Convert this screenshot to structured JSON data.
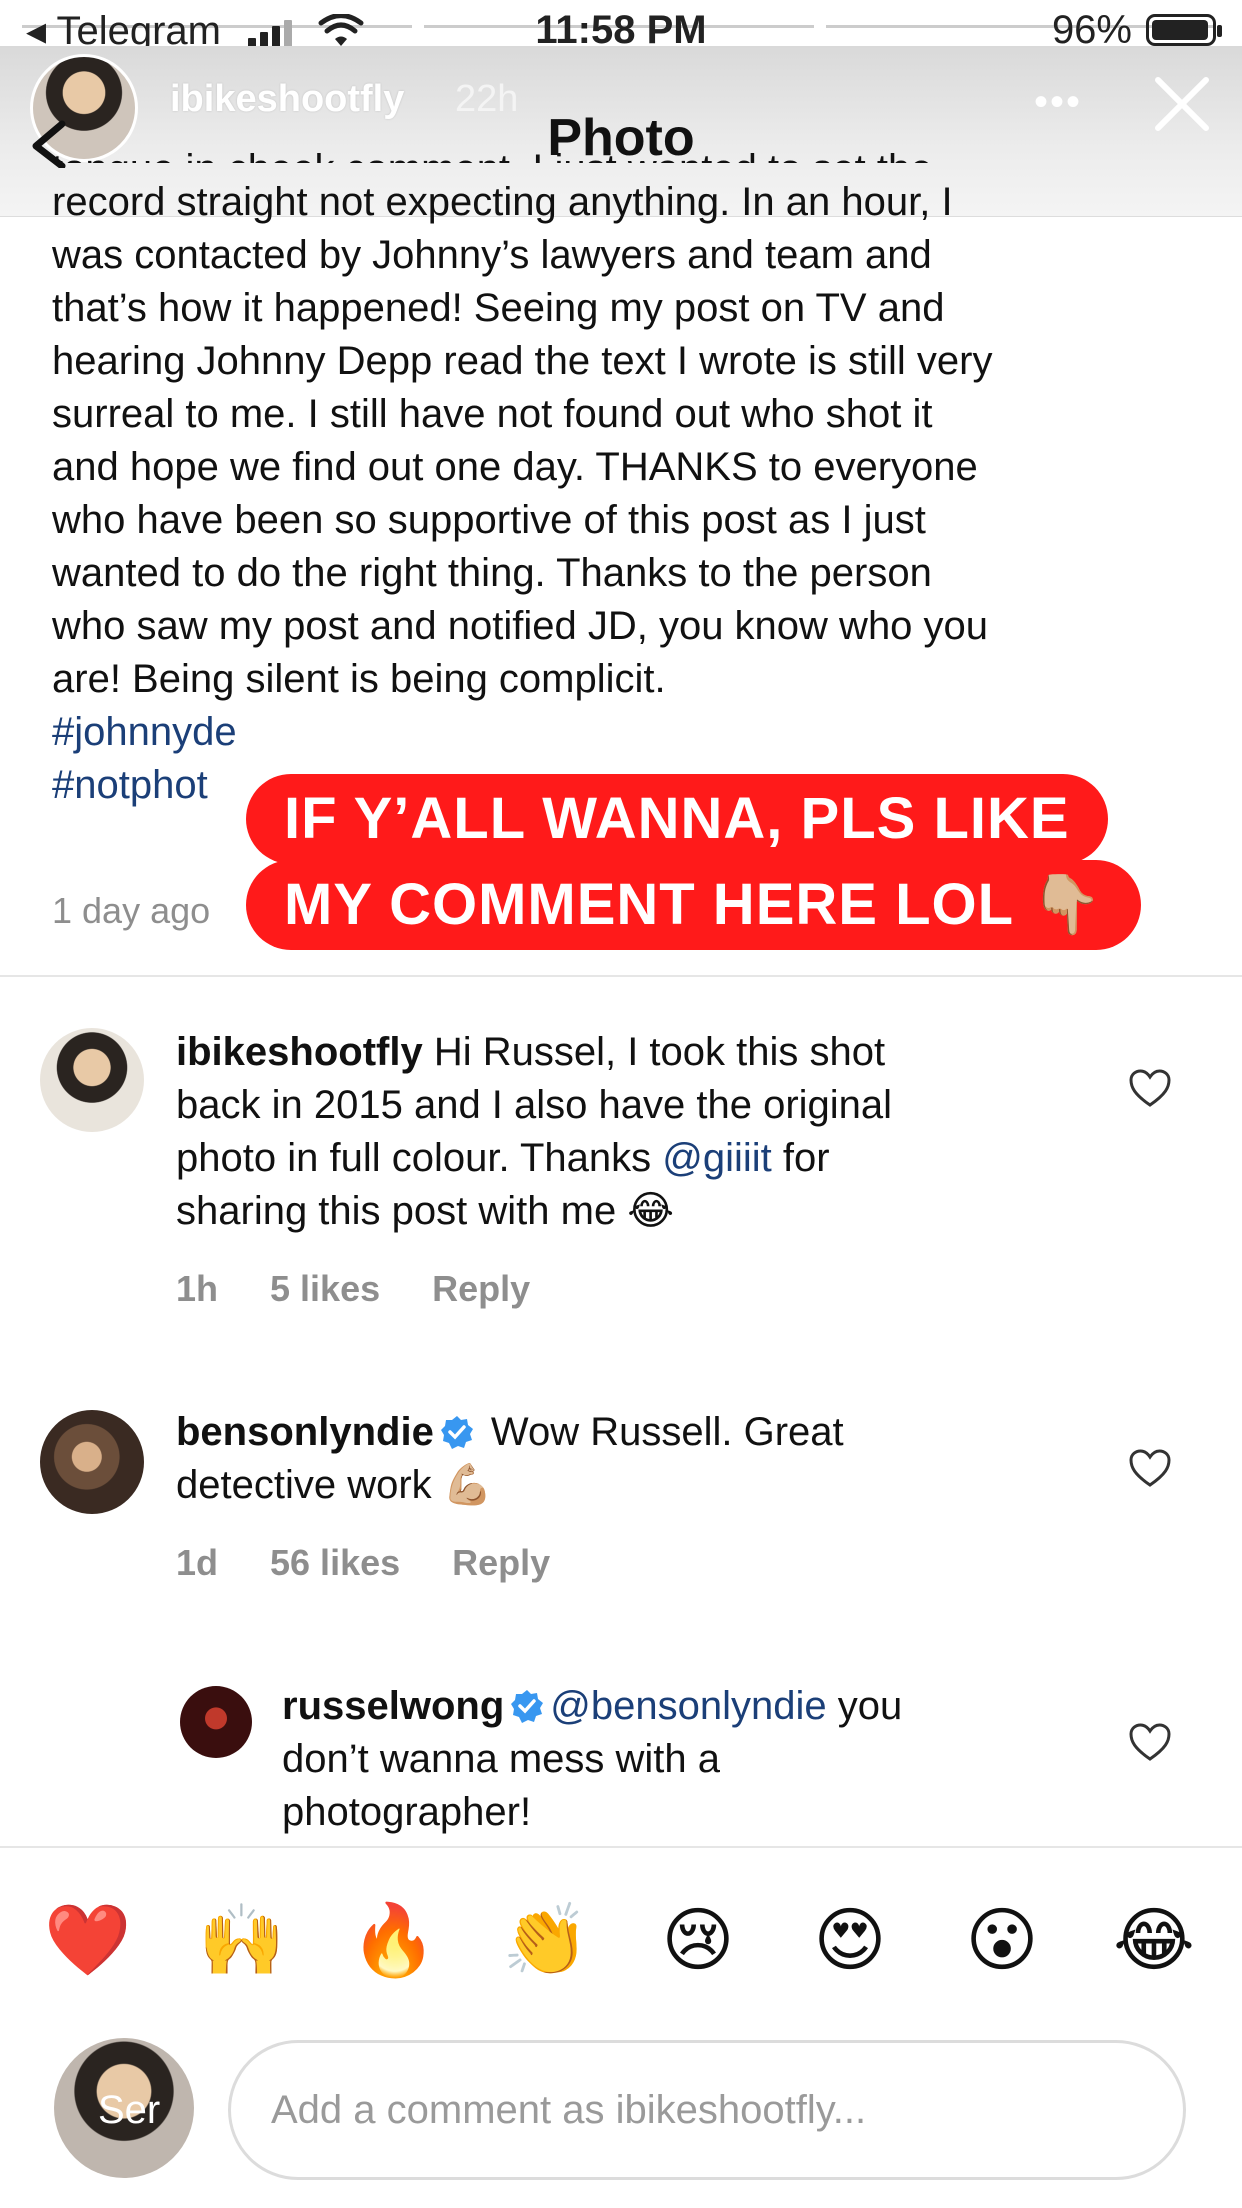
{
  "status_bar": {
    "back_app": "◂ Telegram",
    "time": "11:58 PM",
    "battery": "96%",
    "battery_level": 0.96
  },
  "story": {
    "username": "ibikeshootfly",
    "age": "22h",
    "more_glyph": "•••",
    "page_title": "Photo"
  },
  "caption": {
    "cut_line": "tongue in cheek comment. I just wanted to set the",
    "lines": [
      "record straight not expecting anything.  In an hour, I",
      "was contacted by Johnny’s lawyers and team and",
      "that’s how it happened!  Seeing my post on TV and",
      "hearing Johnny Depp read the text I wrote is still very",
      "surreal to me.  I still have not found out who shot it",
      "and  hope we find out one day.  THANKS to everyone",
      "who have been so supportive of this post as I just",
      "wanted to do the right thing.  Thanks to the person",
      "who saw my post and notified JD,  you know who you",
      "are!  Being silent is being complicit."
    ],
    "hashtag_1": "#johnnyde",
    "hashtag_2": "#notphot",
    "time": "1 day ago"
  },
  "banner": {
    "line1": "IF Y’ALL WANNA, PLS LIKE",
    "line2": "MY COMMENT HERE LOL 👇🏼"
  },
  "comments": [
    {
      "user": "ibikeshootfly",
      "text_before": " Hi Russel, I took this shot",
      "line2": "back in 2015 and I also have the original",
      "line3_before": "photo in full colour. Thanks ",
      "mention": "@giiiit",
      "line3_after": " for",
      "line4": "sharing this post with me 😂",
      "time": "1h",
      "likes": "5 likes",
      "reply": "Reply"
    },
    {
      "user": "bensonlyndie",
      "text_after": " Wow Russell. Great",
      "line2": "detective work 💪🏼",
      "time": "1d",
      "likes": "56 likes",
      "reply": "Reply"
    },
    {
      "user": "russelwong",
      "mention": "@bensonlyndie",
      "text_after": " you",
      "line2": "don’t wanna mess with a",
      "line3": "photographer!"
    }
  ],
  "emoji_bar": [
    "❤️",
    "🙌",
    "🔥",
    "👏",
    "😢",
    "😍",
    "😮",
    "😂"
  ],
  "composer": {
    "placeholder": "Add a comment as ibikeshootfly...",
    "send_overlay": "Ser"
  },
  "colors": {
    "banner_red": "#ff1a1a",
    "link_blue": "#1b3f78",
    "verified_blue": "#3897f0",
    "meta_gray": "#8e8e8e"
  }
}
